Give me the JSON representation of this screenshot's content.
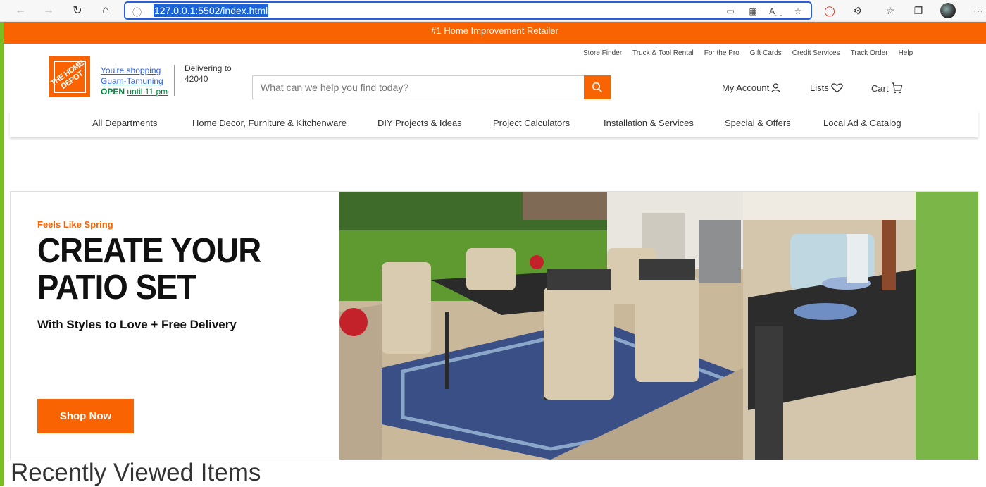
{
  "browser": {
    "url": "127.0.0.1:5502/index.html",
    "info_icon": "info-icon"
  },
  "promo": {
    "text": "#1 Home Improvement Retailer"
  },
  "utility_links": [
    "Store Finder",
    "Truck & Tool Rental",
    "For the Pro",
    "Gift Cards",
    "Credit Services",
    "Track Order",
    "Help"
  ],
  "logo": {
    "text": "THE HOME DEPOT"
  },
  "store": {
    "shopping_label": "You're shopping",
    "store_name": "Guam-Tamuning",
    "open_label": "OPEN",
    "open_time": "until 11 pm"
  },
  "delivery": {
    "label": "Delivering to",
    "zip": "42040"
  },
  "search": {
    "placeholder": "What can we help you find today?"
  },
  "account": {
    "my_account": "My Account",
    "lists": "Lists",
    "cart": "Cart"
  },
  "departments": [
    "All Departments",
    "Home Decor, Furniture & Kitchenware",
    "DIY Projects & Ideas",
    "Project Calculators",
    "Installation & Services",
    "Special & Offers",
    "Local Ad & Catalog"
  ],
  "hero": {
    "kicker": "Feels Like Spring",
    "headline": "CREATE YOUR PATIO SET",
    "subhead": "With Styles to Love + Free Delivery",
    "cta": "Shop Now"
  },
  "recent": {
    "title": "Recently Viewed Items"
  },
  "colors": {
    "brand_orange": "#f96302",
    "accent_green": "#78be20",
    "link_blue": "#2b5fd9"
  }
}
